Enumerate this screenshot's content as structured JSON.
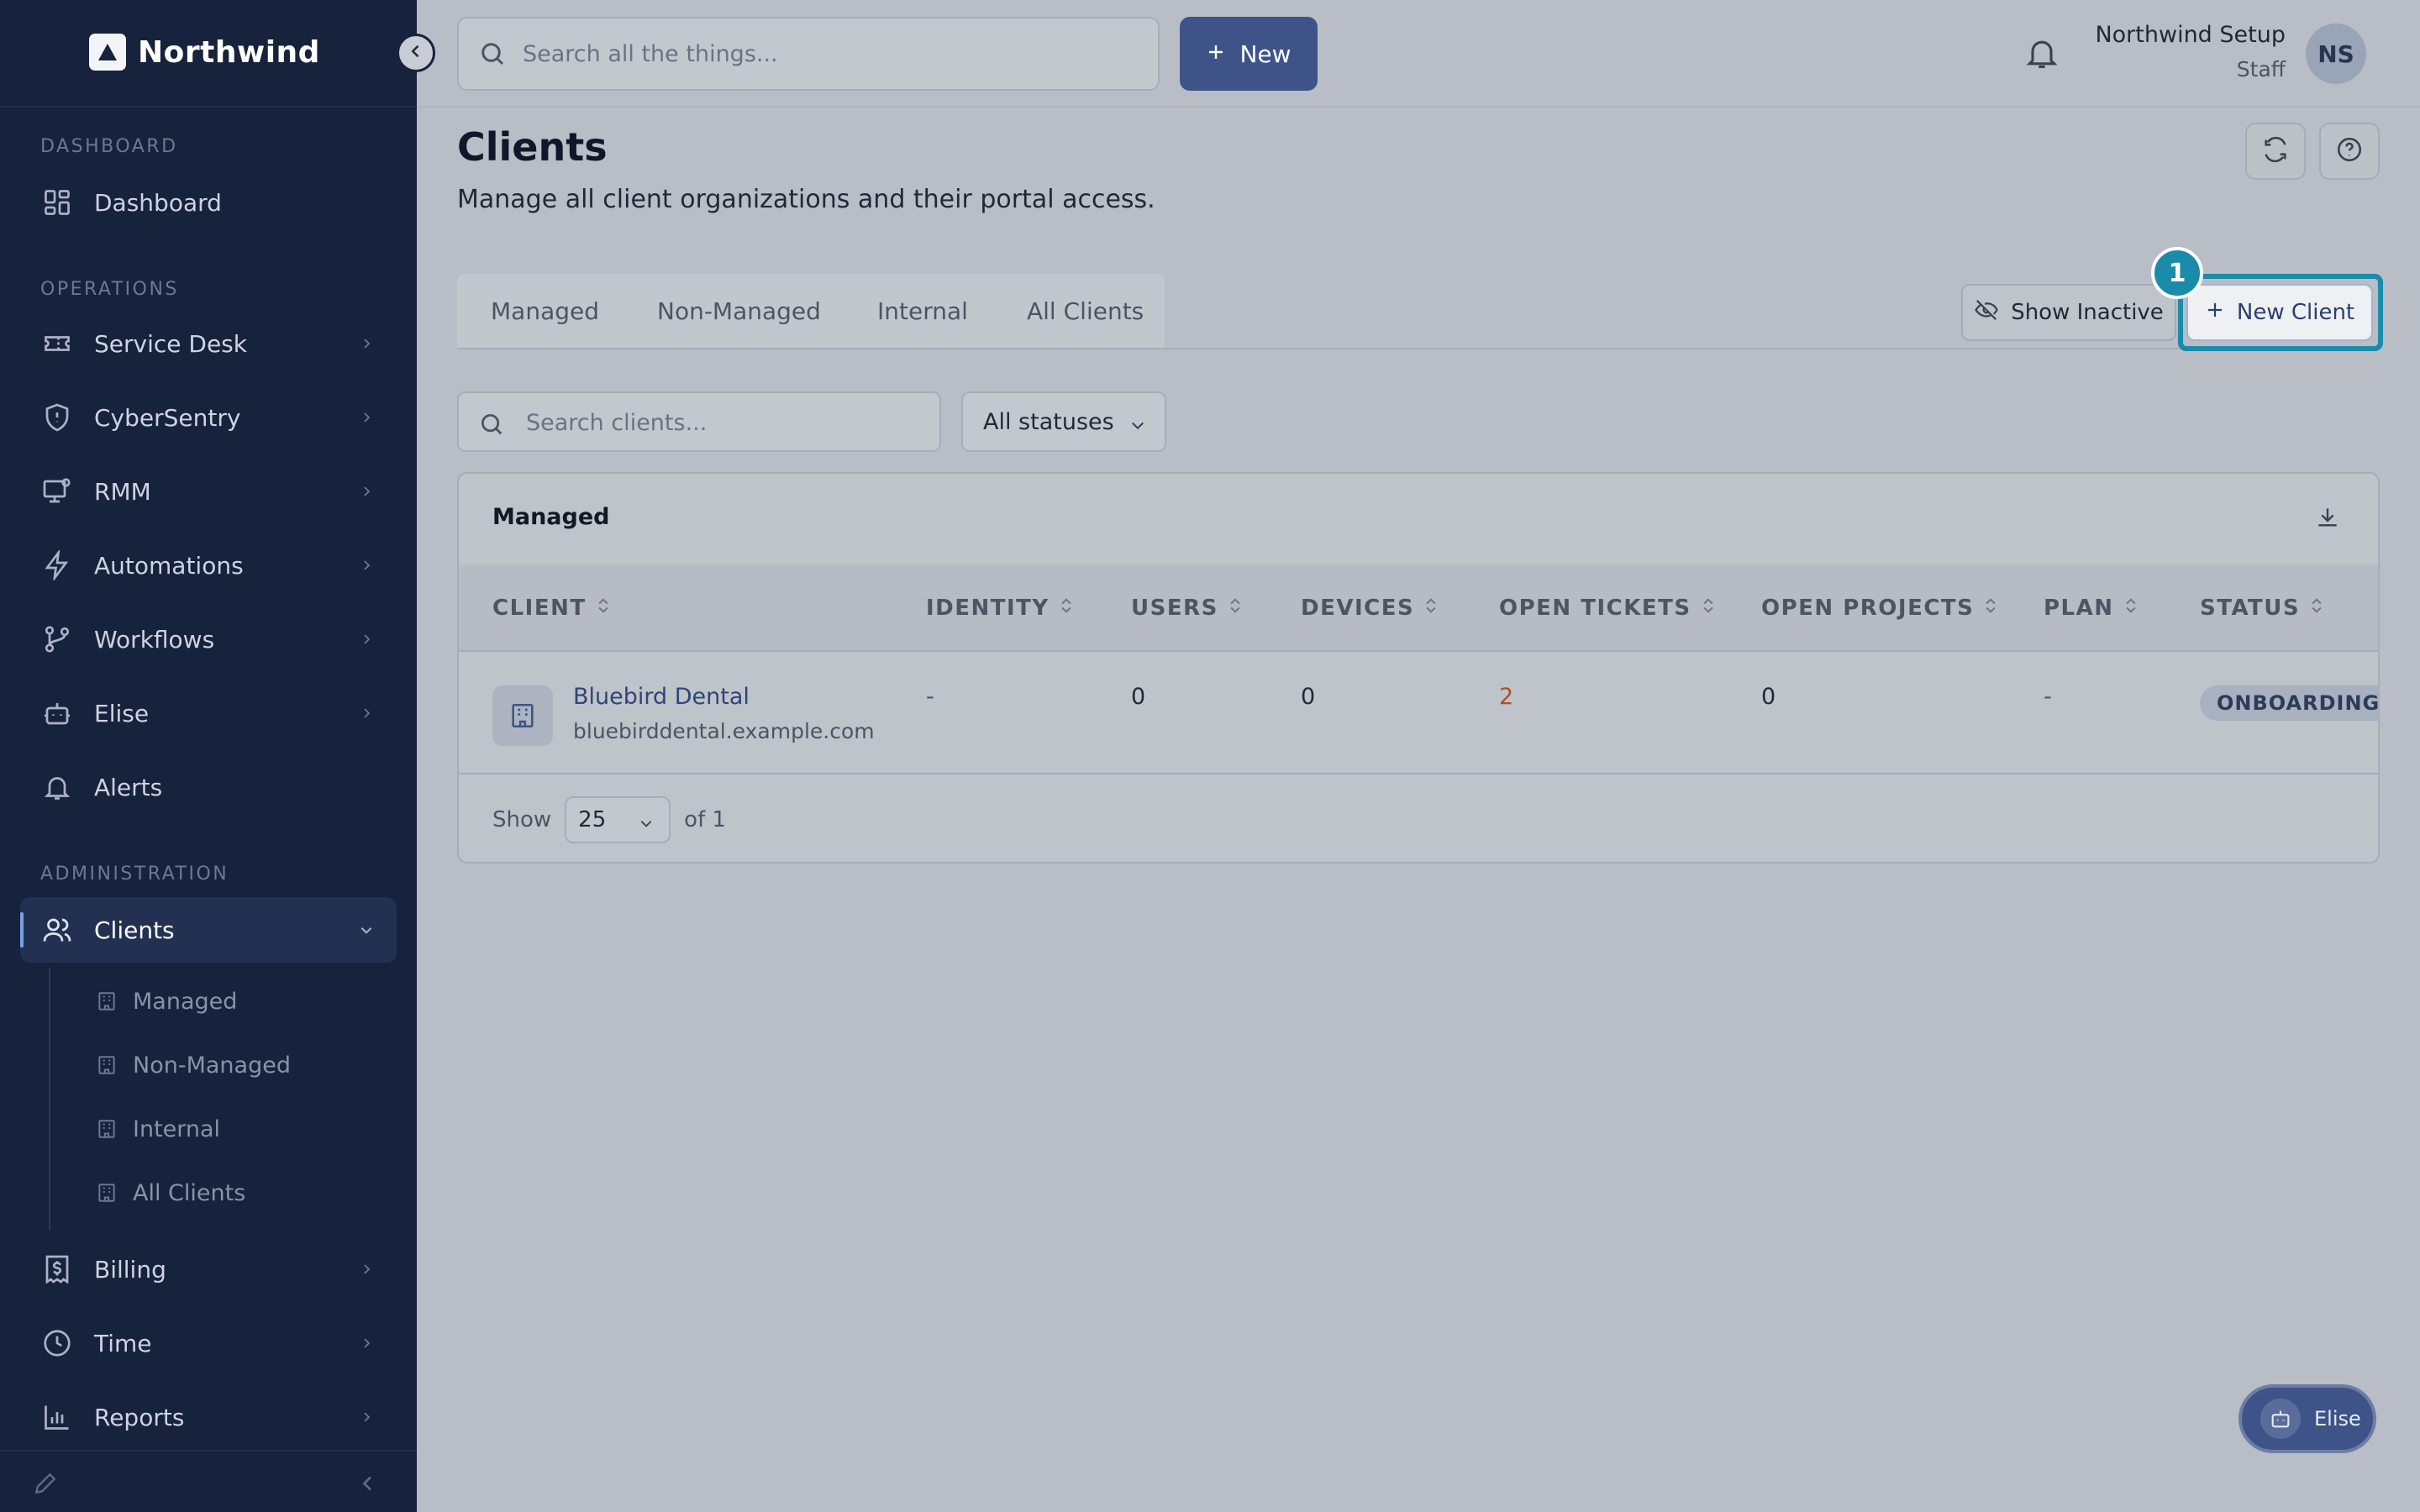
{
  "brand": {
    "name": "Northwind"
  },
  "sidebar": {
    "sections": [
      {
        "label": "DASHBOARD"
      },
      {
        "label": "OPERATIONS"
      },
      {
        "label": "ADMINISTRATION"
      }
    ],
    "items": [
      {
        "label": "Dashboard",
        "icon": "grid-icon"
      },
      {
        "label": "Service Desk",
        "icon": "ticket-icon"
      },
      {
        "label": "CyberSentry",
        "icon": "shield-icon"
      },
      {
        "label": "RMM",
        "icon": "monitor-icon"
      },
      {
        "label": "Automations",
        "icon": "lightning-icon"
      },
      {
        "label": "Workflows",
        "icon": "git-branch-icon"
      },
      {
        "label": "Elise",
        "icon": "robot-icon"
      },
      {
        "label": "Alerts",
        "icon": "bell-icon"
      },
      {
        "label": "Clients",
        "icon": "users-icon",
        "active": true
      },
      {
        "label": "Billing",
        "icon": "receipt-icon"
      },
      {
        "label": "Time",
        "icon": "clock-icon"
      },
      {
        "label": "Reports",
        "icon": "bar-chart-icon"
      }
    ],
    "clients_subitems": [
      {
        "label": "Managed"
      },
      {
        "label": "Non-Managed"
      },
      {
        "label": "Internal"
      },
      {
        "label": "All Clients"
      }
    ]
  },
  "topbar": {
    "search_placeholder": "Search all the things...",
    "new_label": "New",
    "user_name": "Northwind Setup",
    "user_role": "Staff",
    "avatar_initials": "NS"
  },
  "page": {
    "title": "Clients",
    "subtitle": "Manage all client organizations and their portal access.",
    "tabs": [
      {
        "label": "Managed"
      },
      {
        "label": "Non-Managed"
      },
      {
        "label": "Internal"
      },
      {
        "label": "All Clients"
      }
    ],
    "show_inactive_label": "Show Inactive",
    "new_client_label": "New Client",
    "step_number": "1",
    "search_placeholder": "Search clients...",
    "status_filter": "All statuses"
  },
  "table": {
    "title": "Managed",
    "columns": [
      "CLIENT",
      "IDENTITY",
      "USERS",
      "DEVICES",
      "OPEN TICKETS",
      "OPEN PROJECTS",
      "PLAN",
      "STATUS"
    ],
    "rows": [
      {
        "name": "Bluebird Dental",
        "domain": "bluebirddental.example.com",
        "identity": "-",
        "users": "0",
        "devices": "0",
        "open_tickets": "2",
        "open_projects": "0",
        "plan": "-",
        "status": "ONBOARDING"
      }
    ],
    "pager": {
      "show_label": "Show",
      "page_size": "25",
      "of_label": "of 1"
    }
  },
  "assistant": {
    "label": "Elise"
  },
  "colors": {
    "sidebar_bg": "#17223d",
    "primary": "#3e5488",
    "highlight": "#1a8ba8",
    "accent_ticket": "#a4532a"
  }
}
